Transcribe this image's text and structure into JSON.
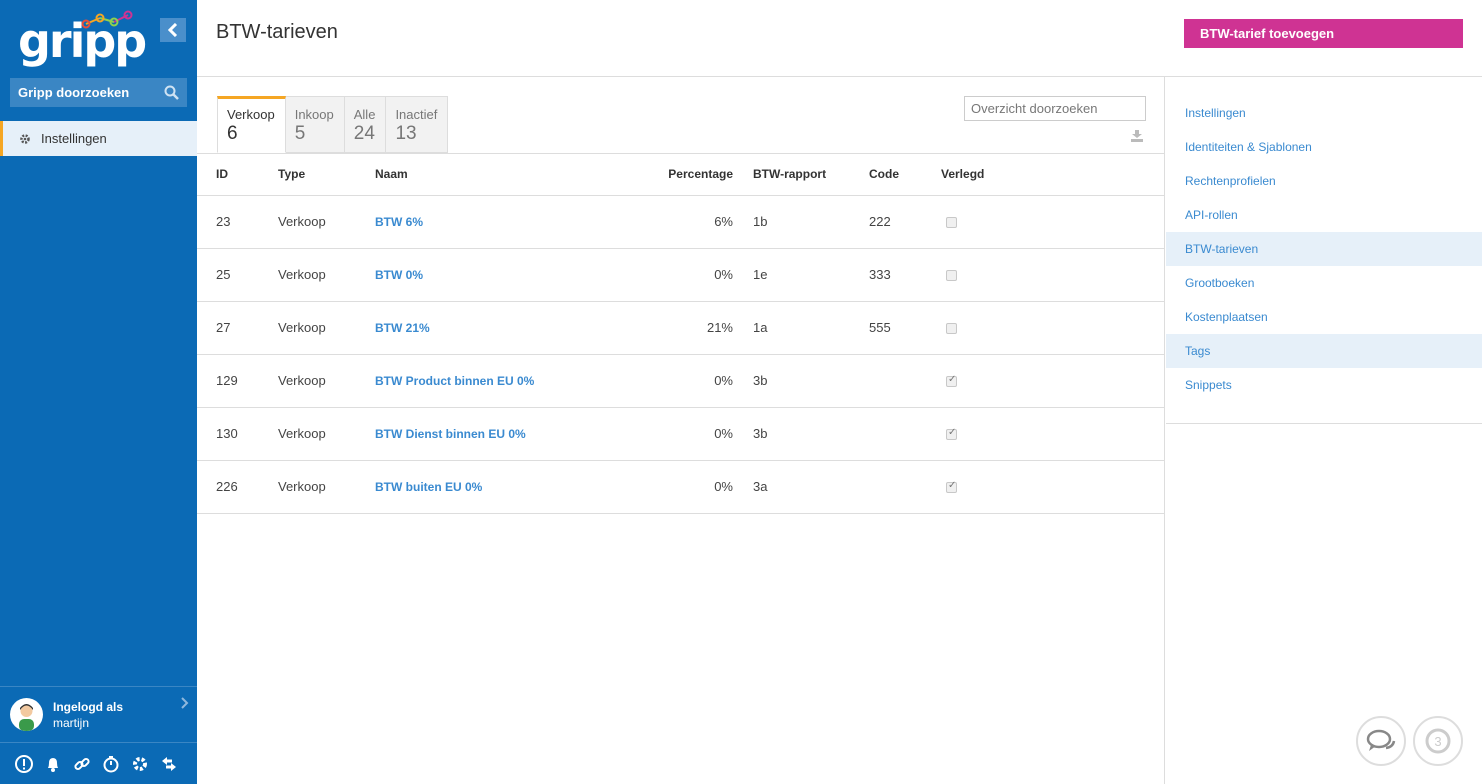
{
  "sidebar": {
    "logo": "gripp",
    "search_label": "Gripp doorzoeken",
    "nav_item": "Instellingen",
    "user_line1": "Ingelogd als",
    "user_line2": "martijn"
  },
  "header": {
    "title": "BTW-tarieven",
    "add_button": "BTW-tarief toevoegen"
  },
  "tabs": [
    {
      "label": "Verkoop",
      "count": "6"
    },
    {
      "label": "Inkoop",
      "count": "5"
    },
    {
      "label": "Alle",
      "count": "24"
    },
    {
      "label": "Inactief",
      "count": "13"
    }
  ],
  "overview_search_placeholder": "Overzicht doorzoeken",
  "table": {
    "headers": [
      "ID",
      "Type",
      "Naam",
      "Percentage",
      "BTW-rapport",
      "Code",
      "Verlegd"
    ],
    "rows": [
      {
        "id": "23",
        "type": "Verkoop",
        "naam": "BTW 6%",
        "pct": "6%",
        "rapport": "1b",
        "code": "222",
        "verlegd": false
      },
      {
        "id": "25",
        "type": "Verkoop",
        "naam": "BTW 0%",
        "pct": "0%",
        "rapport": "1e",
        "code": "333",
        "verlegd": false
      },
      {
        "id": "27",
        "type": "Verkoop",
        "naam": "BTW 21%",
        "pct": "21%",
        "rapport": "1a",
        "code": "555",
        "verlegd": false
      },
      {
        "id": "129",
        "type": "Verkoop",
        "naam": "BTW Product binnen EU 0%",
        "pct": "0%",
        "rapport": "3b",
        "code": "",
        "verlegd": true
      },
      {
        "id": "130",
        "type": "Verkoop",
        "naam": "BTW Dienst binnen EU 0%",
        "pct": "0%",
        "rapport": "3b",
        "code": "",
        "verlegd": true
      },
      {
        "id": "226",
        "type": "Verkoop",
        "naam": "BTW buiten EU 0%",
        "pct": "0%",
        "rapport": "3a",
        "code": "",
        "verlegd": true
      }
    ]
  },
  "settings_menu": [
    {
      "label": "Instellingen",
      "active": false
    },
    {
      "label": "Identiteiten & Sjablonen",
      "active": false
    },
    {
      "label": "Rechtenprofielen",
      "active": false
    },
    {
      "label": "API-rollen",
      "active": false
    },
    {
      "label": "BTW-tarieven",
      "active": true
    },
    {
      "label": "Grootboeken",
      "active": false
    },
    {
      "label": "Kostenplaatsen",
      "active": false
    },
    {
      "label": "Tags",
      "active": true
    },
    {
      "label": "Snippets",
      "active": false
    }
  ],
  "notification_count": "3",
  "colors": {
    "sidebar": "#0b6ab5",
    "accent": "#cf3393",
    "tab_active": "#f5a623",
    "link": "#3a8ad0"
  }
}
